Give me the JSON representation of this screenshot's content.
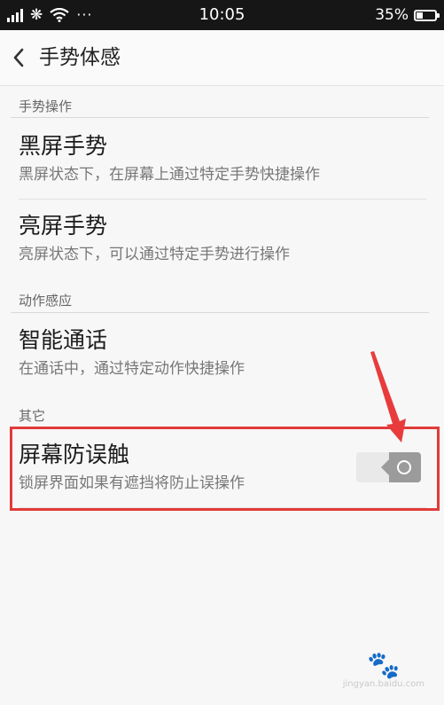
{
  "status_bar": {
    "time": "10:05",
    "battery_percent": "35%",
    "battery_level": 0.35,
    "dots": "···"
  },
  "header": {
    "title": "手势体感"
  },
  "sections": [
    {
      "header": "手势操作",
      "items": [
        {
          "title": "黑屏手势",
          "desc": "黑屏状态下，在屏幕上通过特定手势快捷操作"
        },
        {
          "title": "亮屏手势",
          "desc": "亮屏状态下，可以通过特定手势进行操作"
        }
      ]
    },
    {
      "header": "动作感应",
      "items": [
        {
          "title": "智能通话",
          "desc": "在通话中，通过特定动作快捷操作"
        }
      ]
    },
    {
      "header": "其它",
      "items": [
        {
          "title": "屏幕防误触",
          "desc": "锁屏界面如果有遮挡将防止误操作",
          "toggle_on": true
        }
      ]
    }
  ],
  "annotation": {
    "highlight_color": "#e23a3a"
  },
  "watermark": {
    "text": "jingyan.baidu.com"
  }
}
